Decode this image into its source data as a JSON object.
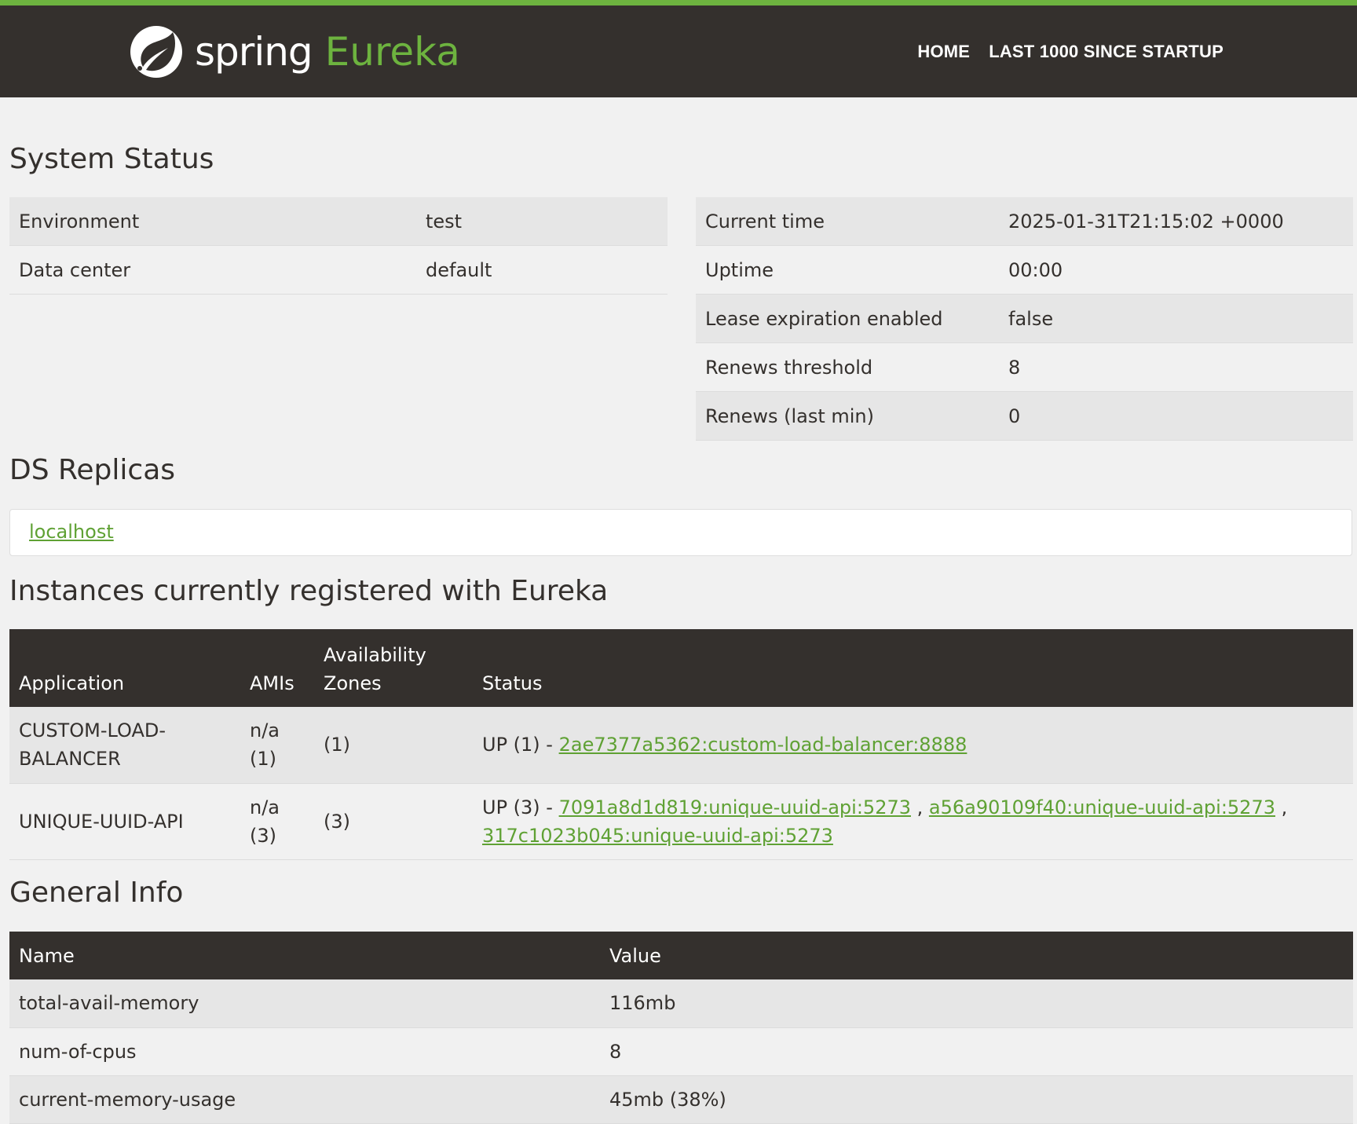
{
  "brand": {
    "spring": "spring",
    "eureka": "Eureka"
  },
  "nav": {
    "home": "HOME",
    "last1000": "LAST 1000 SINCE STARTUP"
  },
  "system_status": {
    "title": "System Status",
    "left": [
      {
        "label": "Environment",
        "value": "test"
      },
      {
        "label": "Data center",
        "value": "default"
      }
    ],
    "right": [
      {
        "label": "Current time",
        "value": "2025-01-31T21:15:02 +0000"
      },
      {
        "label": "Uptime",
        "value": "00:00"
      },
      {
        "label": "Lease expiration enabled",
        "value": "false"
      },
      {
        "label": "Renews threshold",
        "value": "8"
      },
      {
        "label": "Renews (last min)",
        "value": "0"
      }
    ]
  },
  "ds_replicas": {
    "title": "DS Replicas",
    "link": "localhost"
  },
  "instances": {
    "title": "Instances currently registered with Eureka",
    "headers": {
      "application": "Application",
      "amis": "AMIs",
      "zones_line1": "Availability",
      "zones_line2": "Zones",
      "status": "Status"
    },
    "rows": [
      {
        "app_line1": "CUSTOM-LOAD-",
        "app_line2": "BALANCER",
        "amis_line1": "n/a",
        "amis_line2": "(1)",
        "zones": "(1)",
        "status_prefix": "UP (1) - ",
        "links": [
          "2ae7377a5362:custom-load-balancer:8888"
        ]
      },
      {
        "app": "UNIQUE-UUID-API",
        "amis_line1": "n/a",
        "amis_line2": "(3)",
        "zones": "(3)",
        "status_prefix": "UP (3) - ",
        "links": [
          "7091a8d1d819:unique-uuid-api:5273",
          "a56a90109f40:unique-uuid-api:5273",
          "317c1023b045:unique-uuid-api:5273"
        ],
        "separator": " , "
      }
    ]
  },
  "general_info": {
    "title": "General Info",
    "headers": {
      "name": "Name",
      "value": "Value"
    },
    "rows": [
      {
        "name": "total-avail-memory",
        "value": "116mb"
      },
      {
        "name": "num-of-cpus",
        "value": "8"
      },
      {
        "name": "current-memory-usage",
        "value": "45mb (38%)"
      }
    ]
  },
  "colors": {
    "accent": "#6db33f",
    "link": "#5fa134",
    "header_bg": "#34302d",
    "page_bg": "#f1f1f1"
  },
  "icons": {
    "logo": "spring-leaf-logo-icon"
  }
}
